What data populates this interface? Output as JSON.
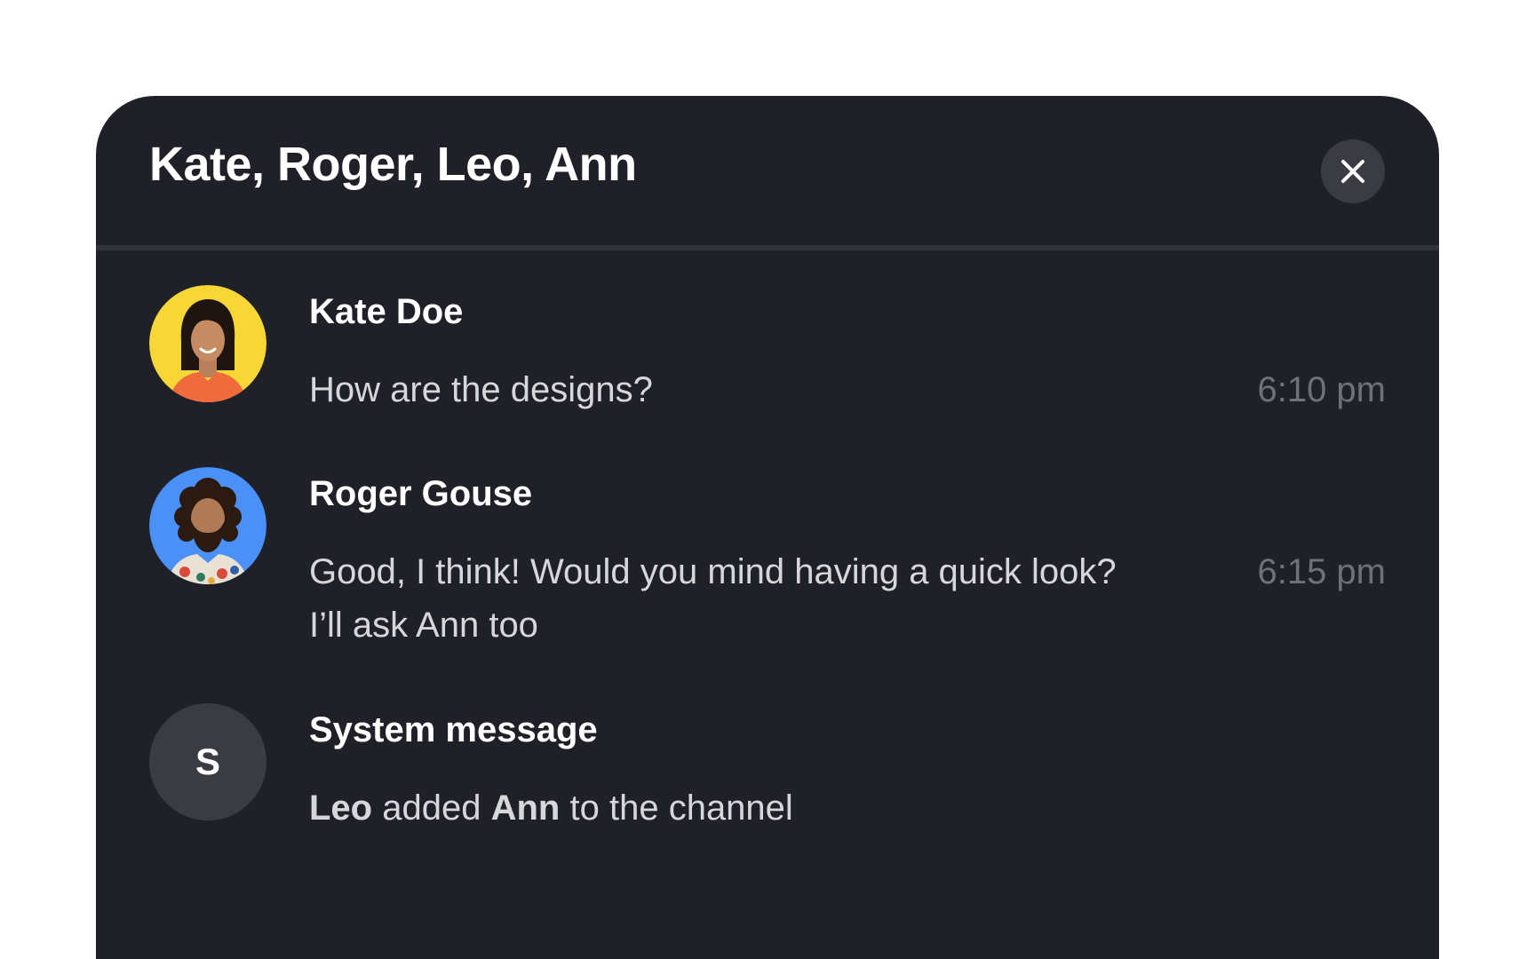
{
  "header": {
    "title": "Kate, Roger, Leo, Ann",
    "close_icon": "close-icon"
  },
  "messages": [
    {
      "sender": "Kate Doe",
      "text": "How are the designs?",
      "time": "6:10 pm",
      "avatar_bg": "#f6d736"
    },
    {
      "sender": "Roger Gouse",
      "text": "Good, I think! Would you mind having a quick look? I’ll ask Ann too",
      "time": "6:15 pm",
      "avatar_bg": "#4a90f7"
    },
    {
      "sender": "System message",
      "avatar_letter": "S",
      "text_parts": {
        "actor": "Leo",
        "verb": "added",
        "target": "Ann",
        "rest": "to the channel"
      }
    }
  ],
  "colors": {
    "panel_bg": "#202128",
    "divider": "#32343b",
    "close_bg": "#3a3b43",
    "text_primary": "#ffffff",
    "text_secondary": "#d6d7db",
    "text_muted": "#6f7178"
  }
}
